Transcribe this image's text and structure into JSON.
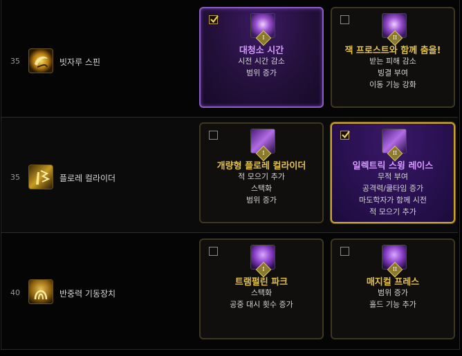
{
  "rows": [
    {
      "level": "35",
      "skill_name": "빗자루 스핀",
      "skill_icon": "broom-spin-icon",
      "options": [
        {
          "title": "대청소 시간",
          "lines": [
            "시전 시간 감소",
            "범위 증가"
          ],
          "tier": "I",
          "checked": true,
          "icon": "tripod-tier1-icon"
        },
        {
          "title": "잭 프로스트와 함께 춤을!",
          "lines": [
            "받는 피해 감소",
            "빙결 부여",
            "이동 기능 강화"
          ],
          "tier": "II",
          "checked": false,
          "icon": "tripod-tier2-icon"
        }
      ]
    },
    {
      "level": "35",
      "skill_name": "플로레 컬라이더",
      "skill_icon": "flore-collider-icon",
      "options": [
        {
          "title": "개량형 플로레 컬라이더",
          "lines": [
            "적 모으기 추가",
            "스택화",
            "범위 증가"
          ],
          "tier": "I",
          "checked": false,
          "icon": "tripod-tier1-icon"
        },
        {
          "title": "일렉트릭 스윙 레이스",
          "lines": [
            "무적 부여",
            "공격력/쿨타임 증가",
            "마도학자가 함께 시전",
            "적 모으기 추가"
          ],
          "tier": "II",
          "checked": true,
          "icon": "tripod-tier2-icon"
        }
      ]
    },
    {
      "level": "40",
      "skill_name": "반중력 기동장치",
      "skill_icon": "antigravity-device-icon",
      "options": [
        {
          "title": "트램펄린 파크",
          "lines": [
            "스택화",
            "공중 대시 횟수 증가"
          ],
          "tier": "I",
          "checked": false,
          "icon": "tripod-tier1-icon"
        },
        {
          "title": "매지컬 프레스",
          "lines": [
            "범위 증가",
            "홀드 기능 추가"
          ],
          "tier": "II",
          "checked": false,
          "icon": "tripod-tier2-icon"
        }
      ]
    }
  ],
  "colors": {
    "title_gold": "#e3c24a",
    "title_purple": "#d79bff",
    "selected_border_gold": "#c8a52b",
    "selected_border_purple": "#8c5cc4"
  }
}
